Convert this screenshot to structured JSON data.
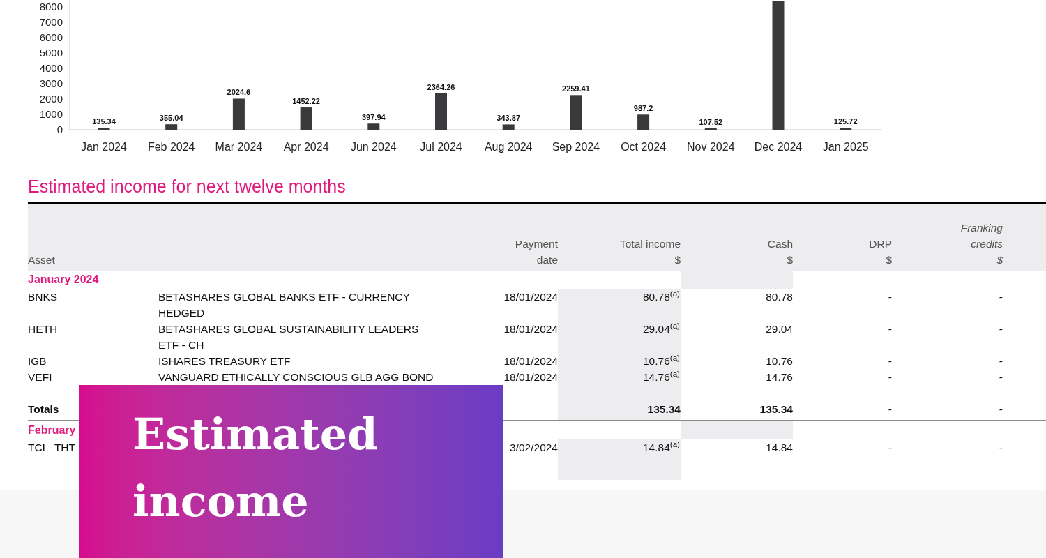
{
  "chart": {
    "chart_data": {
      "type": "bar",
      "categories": [
        "Jan 2024",
        "Feb 2024",
        "Mar 2024",
        "Apr 2024",
        "Jun 2024",
        "Jul 2024",
        "Aug 2024",
        "Sep 2024",
        "Oct 2024",
        "Nov 2024",
        "Dec 2024",
        "Jan 2025"
      ],
      "series": [
        {
          "color": "#3a3a3c",
          "values": [
            135.34,
            355.04,
            2024.6,
            1452.22,
            397.94,
            2364.26,
            343.87,
            2259.41,
            987.2,
            107.52,
            8400,
            125.72
          ]
        }
      ],
      "value_labels": [
        "135.34",
        "355.04",
        "2024.6",
        "1452.22",
        "397.94",
        "2364.26",
        "343.87",
        "2259.41",
        "987.2",
        "107.52",
        null,
        "125.72"
      ],
      "ylim": [
        0,
        8400
      ],
      "yticks": [
        0,
        1000,
        2000,
        3000,
        4000,
        5000,
        6000,
        7000,
        8000
      ]
    }
  },
  "section": {
    "title": "Estimated income for next twelve months"
  },
  "table": {
    "columns": [
      {
        "label": "Asset",
        "italic": false
      },
      {
        "label": "Payment date",
        "italic": false
      },
      {
        "label": "Total income",
        "unit": "$",
        "italic": false
      },
      {
        "label": "Cash",
        "unit": "$",
        "italic": false
      },
      {
        "label": "DRP",
        "unit": "$",
        "italic": false
      },
      {
        "label": "Franking credits",
        "unit": "$",
        "italic": true
      }
    ],
    "rows": [
      {
        "kind": "group",
        "label": "January 2024"
      },
      {
        "kind": "asset",
        "code": "BNKS",
        "name": "BETASHARES GLOBAL BANKS ETF - CURRENCY HEDGED",
        "payment_date": "18/01/2024",
        "total_income": "80.78$^{(a)}$",
        "cash": "80.78",
        "drp": "-",
        "franking_credits": "-"
      },
      {
        "kind": "asset",
        "code": "HETH",
        "name": "BETASHARES GLOBAL SUSTAINABILITY LEADERS ETF - CH",
        "payment_date": "18/01/2024",
        "total_income": "29.04$^{(a)}$",
        "cash": "29.04",
        "drp": "-",
        "franking_credits": "-"
      },
      {
        "kind": "asset",
        "code": "IGB",
        "name": "ISHARES TREASURY ETF",
        "payment_date": "18/01/2024",
        "total_income": "10.76$^{(a)}$",
        "cash": "10.76",
        "drp": "-",
        "franking_credits": "-"
      },
      {
        "kind": "asset",
        "code": "VEFI",
        "name": "VANGUARD ETHICALLY CONSCIOUS GLB AGG BOND",
        "payment_date": "18/01/2024",
        "total_income": "14.76$^{(a)}$",
        "cash": "14.76",
        "drp": "-",
        "franking_credits": "-"
      },
      {
        "kind": "totals",
        "label": "Totals",
        "total_income": "135.34",
        "cash": "135.34",
        "drp": "-",
        "franking_credits": "-"
      },
      {
        "kind": "group",
        "label": "February"
      },
      {
        "kind": "asset",
        "code": "TCL_THT",
        "payment_date": "3/02/2024",
        "total_income": "14.84$^{(a)}$",
        "cash": "14.84",
        "drp": "-",
        "franking_credits": "-"
      }
    ]
  },
  "banner": {
    "title": "Estimated income"
  }
}
